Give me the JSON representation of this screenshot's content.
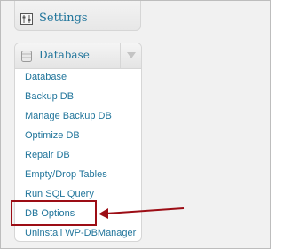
{
  "settings": {
    "label": "Settings",
    "icon": "settings-sliders-icon"
  },
  "database_menu": {
    "title": "Database",
    "icon": "database-icon",
    "toggle_icon": "triangle-down-icon",
    "items": [
      {
        "label": "Database"
      },
      {
        "label": "Backup DB"
      },
      {
        "label": "Manage Backup DB"
      },
      {
        "label": "Optimize DB"
      },
      {
        "label": "Repair DB"
      },
      {
        "label": "Empty/Drop Tables"
      },
      {
        "label": "Run SQL Query"
      },
      {
        "label": "DB Options"
      },
      {
        "label": "Uninstall WP-DBManager"
      }
    ]
  },
  "annotation": {
    "highlighted_item": "DB Options",
    "highlight_color": "#9c0d15"
  },
  "colors": {
    "link": "#21759b",
    "border": "#d6d6d6",
    "background": "#f1f1f1"
  }
}
